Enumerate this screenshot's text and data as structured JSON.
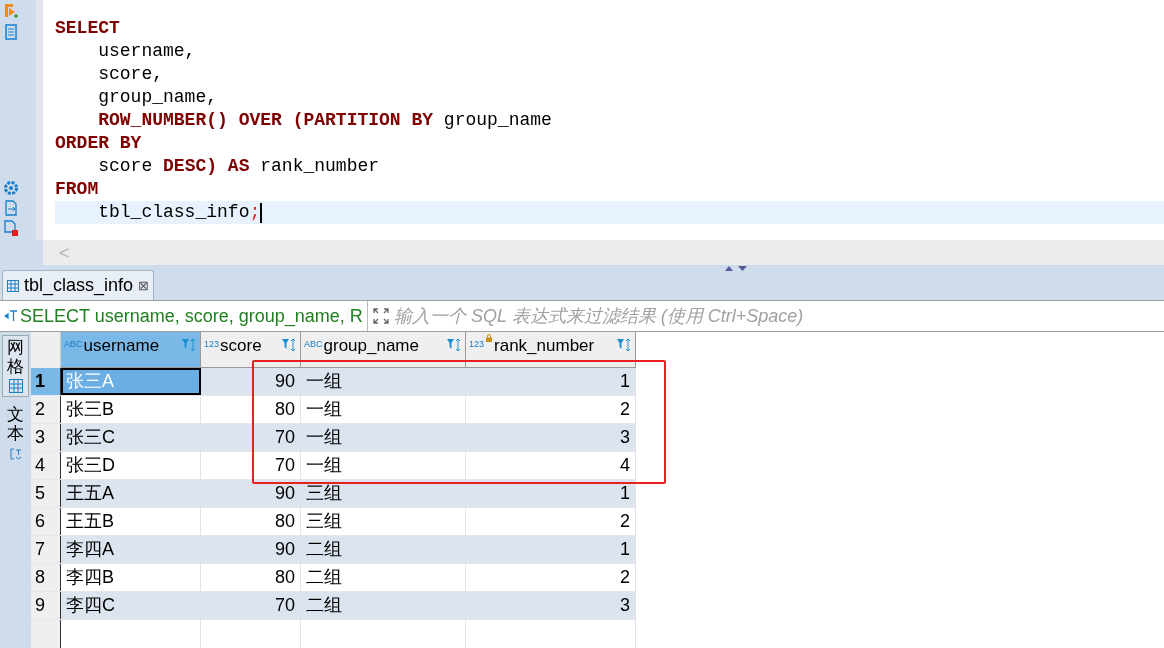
{
  "editor": {
    "lines": [
      {
        "current": false,
        "tokens": [
          {
            "kind": "keyword",
            "text": "SELECT"
          }
        ]
      },
      {
        "current": false,
        "tokens": [
          {
            "kind": "text",
            "text": "    username,"
          }
        ]
      },
      {
        "current": false,
        "tokens": [
          {
            "kind": "text",
            "text": "    score,"
          }
        ]
      },
      {
        "current": false,
        "tokens": [
          {
            "kind": "text",
            "text": "    group_name,"
          }
        ]
      },
      {
        "current": false,
        "tokens": [
          {
            "kind": "keyword",
            "text": "    ROW_NUMBER() OVER (PARTITION BY"
          },
          {
            "kind": "text",
            "text": " group_name"
          }
        ]
      },
      {
        "current": false,
        "tokens": [
          {
            "kind": "keyword",
            "text": "ORDER BY"
          }
        ]
      },
      {
        "current": false,
        "tokens": [
          {
            "kind": "text",
            "text": "    score "
          },
          {
            "kind": "keyword",
            "text": "DESC) AS"
          },
          {
            "kind": "text",
            "text": " rank_number"
          }
        ]
      },
      {
        "current": false,
        "tokens": [
          {
            "kind": "keyword",
            "text": "FROM"
          }
        ]
      },
      {
        "current": true,
        "tokens": [
          {
            "kind": "text",
            "text": "    tbl_class_info"
          },
          {
            "kind": "symbol",
            "text": ";"
          }
        ]
      }
    ],
    "scroll_left": "<"
  },
  "results": {
    "tab": {
      "label": "tbl_class_info",
      "close": "⊠"
    },
    "query": "SELECT username, score, group_name, R",
    "filter": {
      "placeholder": "输入一个 SQL 表达式来过滤结果 (使用 Ctrl+Space)"
    },
    "view_tabs": [
      {
        "label": "网格",
        "selected": true
      },
      {
        "label": "文本",
        "selected": false
      }
    ],
    "columns": [
      {
        "kind": "text",
        "type_label": "ABC",
        "name": "username",
        "locked": false,
        "selected": true
      },
      {
        "kind": "number",
        "type_label": "123",
        "name": "score",
        "locked": false,
        "selected": false
      },
      {
        "kind": "text",
        "type_label": "ABC",
        "name": "group_name",
        "locked": false,
        "selected": false
      },
      {
        "kind": "number",
        "type_label": "123",
        "name": "rank_number",
        "locked": true,
        "selected": false
      }
    ],
    "rows": [
      {
        "number": "1",
        "selected": true,
        "cells": [
          "张三A",
          "90",
          "一组",
          "1"
        ]
      },
      {
        "number": "2",
        "selected": false,
        "cells": [
          "张三B",
          "80",
          "一组",
          "2"
        ]
      },
      {
        "number": "3",
        "selected": false,
        "cells": [
          "张三C",
          "70",
          "一组",
          "3"
        ]
      },
      {
        "number": "4",
        "selected": false,
        "cells": [
          "张三D",
          "70",
          "一组",
          "4"
        ]
      },
      {
        "number": "5",
        "selected": false,
        "cells": [
          "王五A",
          "90",
          "三组",
          "1"
        ]
      },
      {
        "number": "6",
        "selected": false,
        "cells": [
          "王五B",
          "80",
          "三组",
          "2"
        ]
      },
      {
        "number": "7",
        "selected": false,
        "cells": [
          "李四A",
          "90",
          "二组",
          "1"
        ]
      },
      {
        "number": "8",
        "selected": false,
        "cells": [
          "李四B",
          "80",
          "二组",
          "2"
        ]
      },
      {
        "number": "9",
        "selected": false,
        "cells": [
          "李四C",
          "70",
          "二组",
          "3"
        ]
      }
    ]
  }
}
